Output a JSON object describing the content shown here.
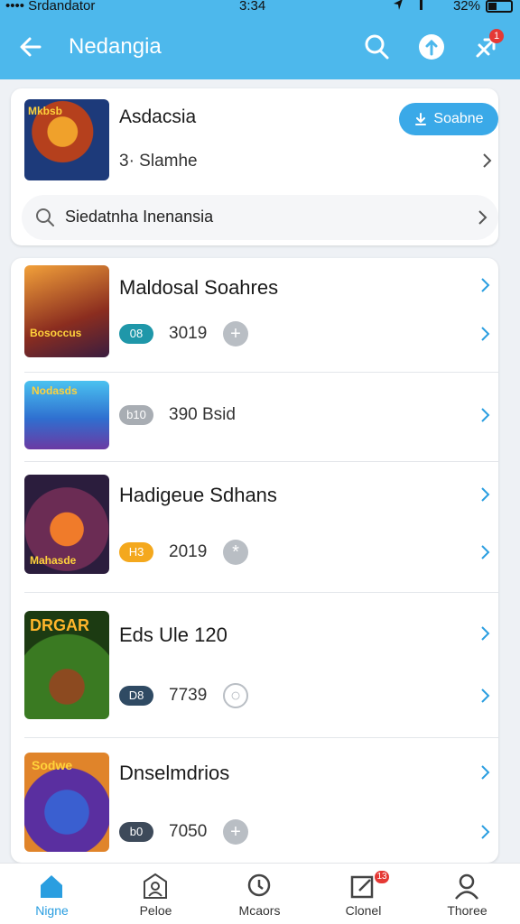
{
  "status_bar": {
    "carrier": "•••• Srdandator",
    "time": "3:34",
    "battery": "32%"
  },
  "header": {
    "title": "Nedangia",
    "notif_count": "1"
  },
  "featured": {
    "name": "Asdacsia",
    "subtitle": "3· Slamhe",
    "button_label": "Soabne",
    "thumb_text": "Mkbsb",
    "search_text": "Siedatnha Inenansia"
  },
  "list": [
    {
      "name": "Maldosal Soahres",
      "tag": "08",
      "tag_color": "#1f97a9",
      "count": "3019",
      "plus": "+",
      "thumb_text": "Bosoccus",
      "thumb_bg": "#c8632a"
    },
    {
      "name": "",
      "tag": "b10",
      "tag_color": "#a8adb3",
      "count": "390 Bsid",
      "plus": "",
      "thumb_text": "Nodasds",
      "thumb_bg": "#3d8fd6"
    },
    {
      "name": "Hadigeue Sdhans",
      "tag": "H3",
      "tag_color": "#f4a81d",
      "count": "2019",
      "plus": "*",
      "thumb_text": "Mahasde",
      "thumb_bg": "#7a2f55"
    },
    {
      "name": "Eds Ule 120",
      "tag": "D8",
      "tag_color": "#2f4a63",
      "count": "7739",
      "plus": "○",
      "thumb_text": "DRGAR",
      "thumb_bg": "#3f8a2a"
    },
    {
      "name": "Dnselmdrios",
      "tag": "b0",
      "tag_color": "#3d4a5a",
      "count": "7050",
      "plus": "+",
      "thumb_text": "Sodwe",
      "thumb_bg": "#4b3aa4"
    }
  ],
  "bottom_nav": [
    {
      "label": "Nigne",
      "badge": ""
    },
    {
      "label": "Peloe",
      "badge": ""
    },
    {
      "label": "Mcaors",
      "badge": ""
    },
    {
      "label": "Clonel",
      "badge": "13"
    },
    {
      "label": "Thoree",
      "badge": ""
    }
  ],
  "colors": {
    "header": "#4db8ec",
    "accent": "#3aa9e8",
    "active_nav": "#2a9ee0"
  }
}
